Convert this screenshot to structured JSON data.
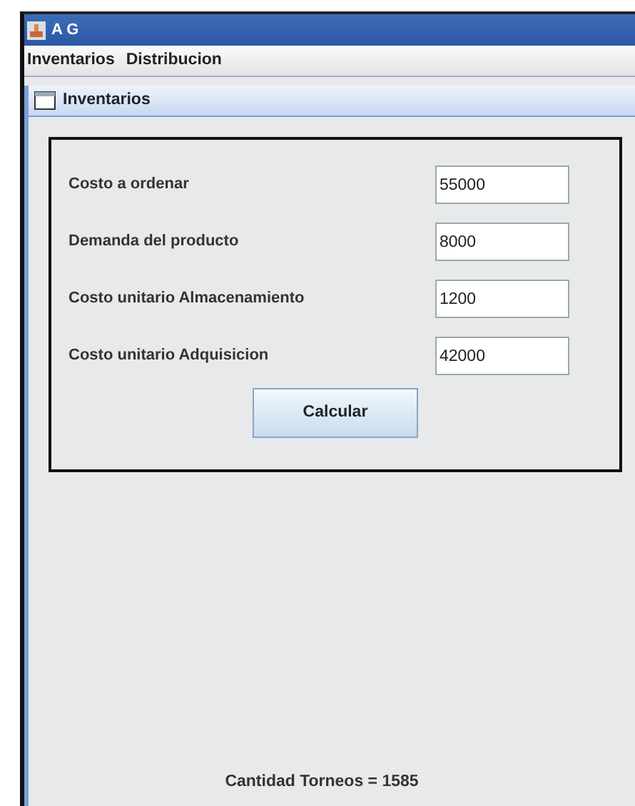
{
  "window": {
    "title": "A G"
  },
  "menu": [
    "Inventarios",
    "Distribucion"
  ],
  "internal_frame": {
    "title": "Inventarios"
  },
  "fields": [
    {
      "label": "Costo a ordenar",
      "value": "55000"
    },
    {
      "label": "Demanda del producto",
      "value": "8000"
    },
    {
      "label": "Costo unitario Almacenamiento",
      "value": "1200"
    },
    {
      "label": "Costo unitario Adquisicion",
      "value": "42000"
    }
  ],
  "button": "Calcular",
  "status": "Cantidad Torneos = 1585"
}
